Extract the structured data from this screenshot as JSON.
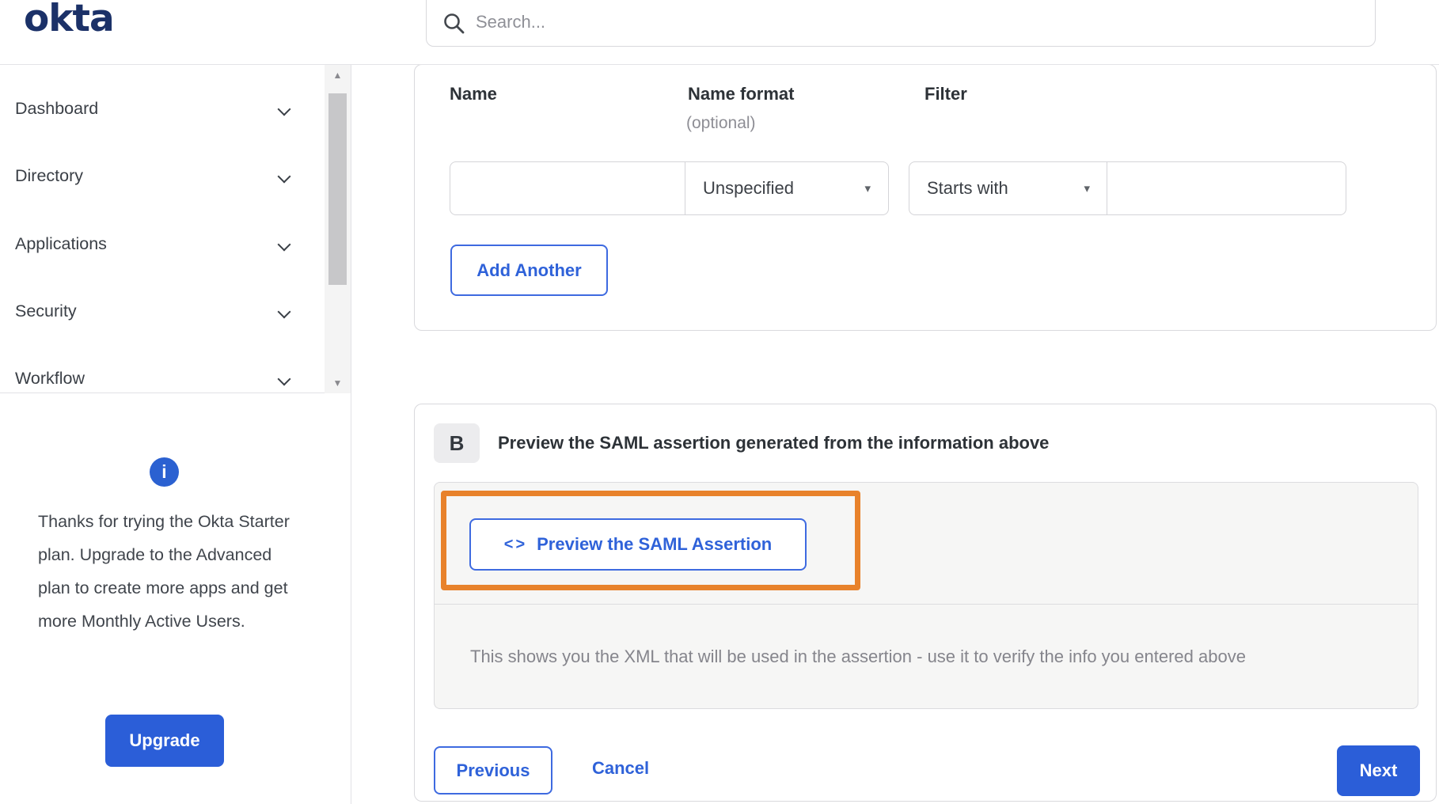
{
  "header": {
    "logo": "okta",
    "search_placeholder": "Search..."
  },
  "sidebar": {
    "items": [
      {
        "label": "Dashboard"
      },
      {
        "label": "Directory"
      },
      {
        "label": "Applications"
      },
      {
        "label": "Security"
      },
      {
        "label": "Workflow"
      }
    ],
    "upsell": {
      "text": "Thanks for trying the Okta Starter plan. Upgrade to the Advanced plan to create more apps and get more Monthly Active Users.",
      "button": "Upgrade"
    }
  },
  "form": {
    "labels": {
      "name": "Name",
      "name_format": "Name format",
      "optional": "(optional)",
      "filter": "Filter"
    },
    "name_value": "",
    "name_format_value": "Unspecified",
    "filter_op_value": "Starts with",
    "filter_value": "",
    "add_another": "Add Another"
  },
  "section_b": {
    "badge": "B",
    "title": "Preview the SAML assertion generated from the information above",
    "code_icon": "<>",
    "preview_button": "Preview the SAML Assertion",
    "hint": "This shows you the XML that will be used in the assertion - use it to verify the info you entered above"
  },
  "footer": {
    "previous": "Previous",
    "cancel": "Cancel",
    "next": "Next"
  },
  "glyphs": {
    "caret": "▾",
    "scroll_up": "▲",
    "scroll_down": "▼",
    "info": "i"
  },
  "colors": {
    "accent_blue": "#2b5ed8",
    "link_blue": "#2f62d9",
    "logo_navy": "#1b3168",
    "highlight_orange": "#e8822b",
    "panel_gray": "#f6f6f5"
  }
}
